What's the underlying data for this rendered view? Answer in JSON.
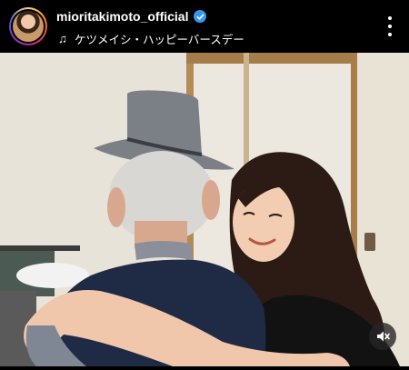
{
  "post": {
    "username": "mioritakimoto_official",
    "verified": true,
    "audio_title": "ケツメイシ・ハッピーバースデー"
  },
  "icons": {
    "avatar": "profile-avatar",
    "verified": "verified-badge-icon",
    "audio": "music-note-icon",
    "more": "more-options-icon",
    "mute": "volume-muted-icon"
  },
  "colors": {
    "background": "#000000",
    "verified_badge": "#3897f0",
    "text": "#ffffff"
  }
}
